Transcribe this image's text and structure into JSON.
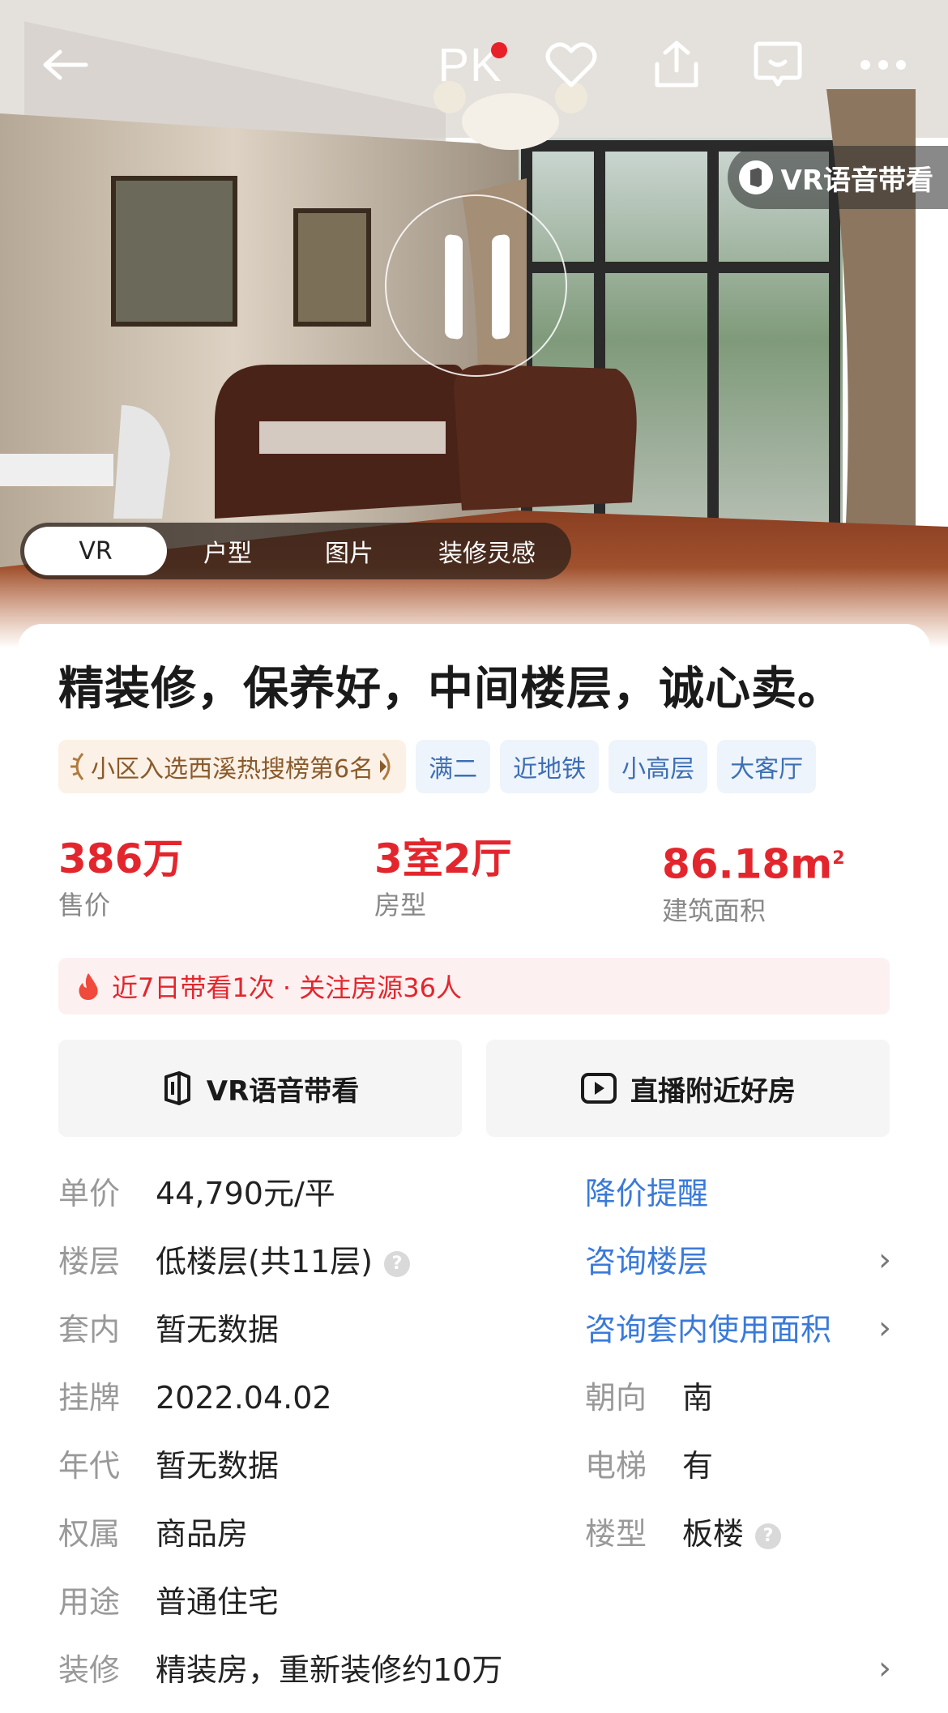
{
  "top_nav": {
    "pk_label": "PK"
  },
  "hero": {
    "vr_badge_label": "VR语音带看",
    "media_tabs": [
      {
        "label": "VR",
        "active": true
      },
      {
        "label": "户型",
        "active": false
      },
      {
        "label": "图片",
        "active": false
      },
      {
        "label": "装修灵感",
        "active": false
      }
    ]
  },
  "listing": {
    "title": "精装修，保养好，中间楼层，诚心卖。",
    "rank_tag": "小区入选西溪热搜榜第6名",
    "tags": [
      "满二",
      "近地铁",
      "小高层",
      "大客厅"
    ],
    "stats": [
      {
        "value": "386万",
        "label": "售价"
      },
      {
        "value": "3室2厅",
        "label": "房型"
      },
      {
        "value": "86.18m",
        "unit_sup": "2",
        "label": "建筑面积"
      }
    ],
    "hot_text": "近7日带看1次 · 关注房源36人"
  },
  "actions": {
    "vr_tour": "VR语音带看",
    "live": "直播附近好房"
  },
  "details": {
    "unit_price": {
      "key": "单价",
      "value": "44,790元/平",
      "link": "降价提醒"
    },
    "floor": {
      "key": "楼层",
      "value": "低楼层(共11层)",
      "help": "?",
      "link": "咨询楼层"
    },
    "inner_area": {
      "key": "套内",
      "value": "暂无数据",
      "link": "咨询套内使用面积"
    },
    "listed": {
      "key": "挂牌",
      "value": "2022.04.02"
    },
    "orientation": {
      "key": "朝向",
      "value": "南"
    },
    "year": {
      "key": "年代",
      "value": "暂无数据"
    },
    "elevator": {
      "key": "电梯",
      "value": "有"
    },
    "ownership": {
      "key": "权属",
      "value": "商品房"
    },
    "building_type": {
      "key": "楼型",
      "value": "板楼",
      "help": "?"
    },
    "usage": {
      "key": "用途",
      "value": "普通住宅"
    },
    "decoration": {
      "key": "装修",
      "value": "精装房，重新装修约10万"
    }
  },
  "colors": {
    "price_red": "#e3262d",
    "link_blue": "#3a7ad9",
    "tag_blue_bg": "#eef4fb",
    "rank_bg": "#fbf1e6"
  }
}
